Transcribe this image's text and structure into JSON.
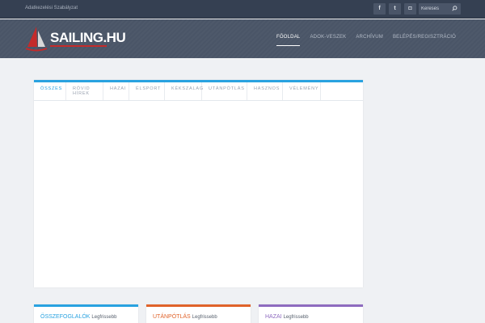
{
  "topbar": {
    "policy_link": "Adatkezelési Szabályzat",
    "social": [
      {
        "icon": "facebook-icon",
        "glyph": "f"
      },
      {
        "icon": "twitter-icon",
        "glyph": "t"
      },
      {
        "icon": "instagram-icon",
        "glyph": "◘"
      }
    ],
    "search_placeholder": "Keresés"
  },
  "header": {
    "brand": "SAILING.HU",
    "nav": [
      "FŐOLDAL",
      "ADOK-VESZEK",
      "ARCHÍVUM",
      "BELÉPÉS/REGISZTRÁCIÓ"
    ],
    "active_nav": "FŐOLDAL"
  },
  "panel": {
    "accent": "#29a2e0",
    "tabs": [
      "ÖSSZES",
      "RÖVID HÍREK",
      "HAZAI",
      "ÉLSPORT",
      "KÉKSZALAG",
      "UTÁNPÓTLÁS",
      "HASZNOS",
      "VÉLEMÉNY"
    ],
    "active_tab": "ÖSSZES"
  },
  "cards": [
    {
      "category": "ÖSSZEFOGLALÓK",
      "suffix": "Legfrissebb",
      "color": "#29a2e0"
    },
    {
      "category": "UTÁNPÓTLÁS",
      "suffix": "Legfrissebb",
      "color": "#e0632a"
    },
    {
      "category": "HAZAI",
      "suffix": "Legfrissebb",
      "color": "#8e6bbf"
    }
  ]
}
